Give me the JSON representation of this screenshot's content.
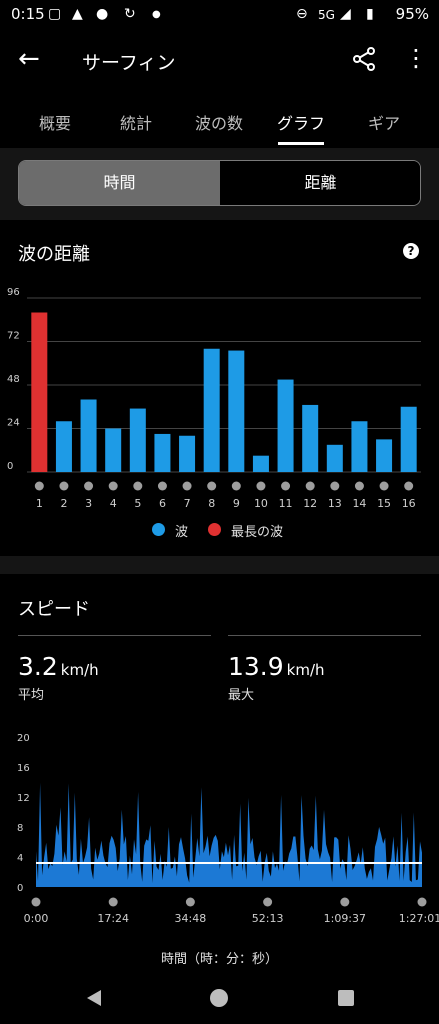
{
  "status": {
    "time": "0:15",
    "network": "5G",
    "battery": "95%"
  },
  "appbar": {
    "title": "サーフィン"
  },
  "tabs": [
    "概要",
    "統計",
    "波の数",
    "グラフ",
    "ギア"
  ],
  "segment": {
    "selected": "時間",
    "other": "距離"
  },
  "wave_chart": {
    "title": "波の距離",
    "colors": {
      "wave": "#1e9be6",
      "longest": "#e03131"
    },
    "legend": [
      "波",
      "最長の波"
    ],
    "chart_data": {
      "type": "bar",
      "categories": [
        "1",
        "2",
        "3",
        "4",
        "5",
        "6",
        "7",
        "8",
        "9",
        "10",
        "11",
        "12",
        "13",
        "14",
        "15",
        "16"
      ],
      "values": [
        88,
        28,
        40,
        24,
        35,
        21,
        20,
        68,
        67,
        9,
        51,
        37,
        15,
        28,
        18,
        36
      ],
      "highlight_index": 0,
      "ylim": [
        0,
        96
      ],
      "yticks": [
        0,
        24,
        48,
        72,
        96
      ]
    }
  },
  "speed": {
    "title": "スピード",
    "avg_value": "3.2",
    "avg_unit": "km/h",
    "avg_label": "平均",
    "max_value": "13.9",
    "max_unit": "km/h",
    "max_label": "最大",
    "axis_title": "時間（時：分：秒）",
    "chart_data": {
      "type": "area",
      "ylim": [
        0,
        20
      ],
      "yticks": [
        0,
        4,
        8,
        12,
        16,
        20
      ],
      "xlim_seconds": [
        0,
        5221
      ],
      "xtick_labels": [
        "0:00",
        "17:24",
        "34:48",
        "52:13",
        "1:09:37",
        "1:27:01"
      ],
      "average_line": 3.2,
      "max": 13.9,
      "color": "#1e7fe0"
    }
  }
}
